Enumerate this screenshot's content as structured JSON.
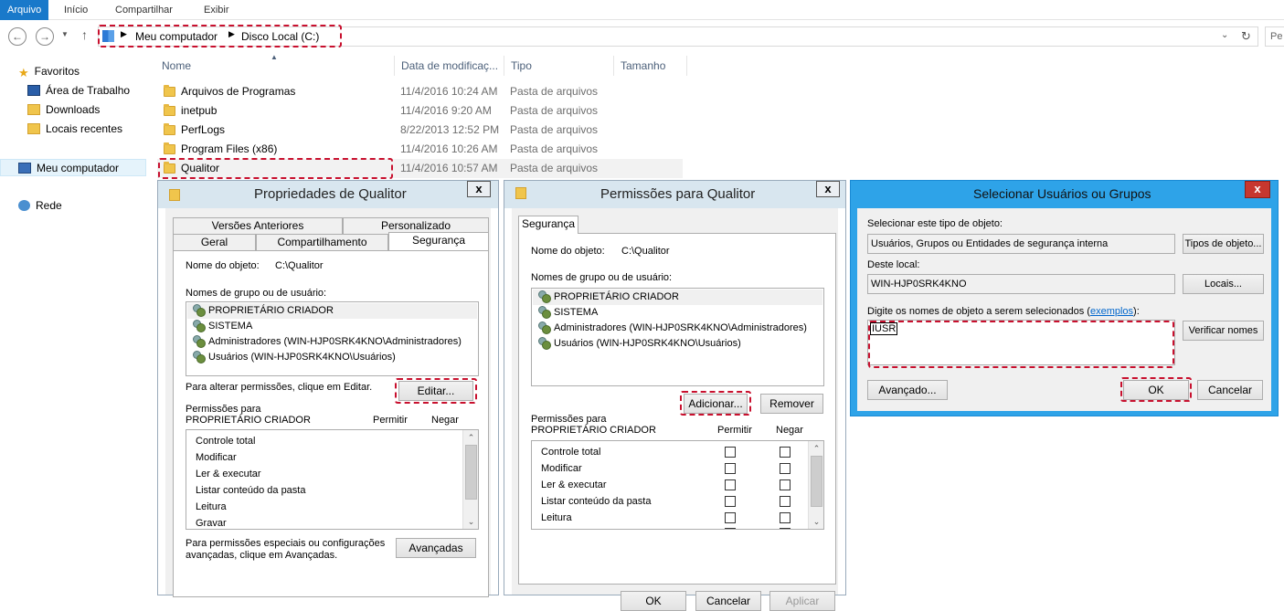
{
  "ribbon": {
    "tabs": [
      "Arquivo",
      "Início",
      "Compartilhar",
      "Exibir"
    ]
  },
  "address": {
    "part1": "Meu computador",
    "part2": "Disco Local (C:)",
    "search_placeholder": "Pe"
  },
  "nav": {
    "favorites": "Favoritos",
    "items": [
      "Área de Trabalho",
      "Downloads",
      "Locais recentes"
    ],
    "computer": "Meu computador",
    "network": "Rede"
  },
  "columns": {
    "name": "Nome",
    "date": "Data de modificaç...",
    "type": "Tipo",
    "size": "Tamanho"
  },
  "files": [
    {
      "name": "Arquivos de Programas",
      "date": "11/4/2016 10:24 AM",
      "type": "Pasta de arquivos"
    },
    {
      "name": "inetpub",
      "date": "11/4/2016 9:20 AM",
      "type": "Pasta de arquivos"
    },
    {
      "name": "PerfLogs",
      "date": "8/22/2013 12:52 PM",
      "type": "Pasta de arquivos"
    },
    {
      "name": "Program Files (x86)",
      "date": "11/4/2016 10:26 AM",
      "type": "Pasta de arquivos"
    },
    {
      "name": "Qualitor",
      "date": "11/4/2016 10:57 AM",
      "type": "Pasta de arquivos"
    }
  ],
  "props": {
    "title": "Propriedades de Qualitor",
    "tabs_top": [
      "Versões Anteriores",
      "Personalizado"
    ],
    "tabs_bottom": [
      "Geral",
      "Compartilhamento",
      "Segurança"
    ],
    "object_label": "Nome do objeto:",
    "object_value": "C:\\Qualitor",
    "groups_label": "Nomes de grupo ou de usuário:",
    "groups": [
      "PROPRIETÁRIO CRIADOR",
      "SISTEMA",
      "Administradores (WIN-HJP0SRK4KNO\\Administradores)",
      "Usuários (WIN-HJP0SRK4KNO\\Usuários)"
    ],
    "edit_hint": "Para alterar permissões, clique em Editar.",
    "edit_button": "Editar...",
    "perm_for": "Permissões para",
    "perm_for_who": "PROPRIETÁRIO CRIADOR",
    "allow": "Permitir",
    "deny": "Negar",
    "permissions": [
      "Controle total",
      "Modificar",
      "Ler & executar",
      "Listar conteúdo da pasta",
      "Leitura",
      "Gravar"
    ],
    "adv_hint_1": "Para permissões especiais ou configurações",
    "adv_hint_2": "avançadas, clique em Avançadas.",
    "adv_button": "Avançadas"
  },
  "perms": {
    "title": "Permissões para Qualitor",
    "tab": "Segurança",
    "object_label": "Nome do objeto:",
    "object_value": "C:\\Qualitor",
    "groups_label": "Nomes de grupo ou de usuário:",
    "groups": [
      "PROPRIETÁRIO CRIADOR",
      "SISTEMA",
      "Administradores (WIN-HJP0SRK4KNO\\Administradores)",
      "Usuários (WIN-HJP0SRK4KNO\\Usuários)"
    ],
    "add_button": "Adicionar...",
    "remove_button": "Remover",
    "perm_for": "Permissões para",
    "perm_for_who": "PROPRIETÁRIO CRIADOR",
    "allow": "Permitir",
    "deny": "Negar",
    "permissions": [
      "Controle total",
      "Modificar",
      "Ler & executar",
      "Listar conteúdo da pasta",
      "Leitura"
    ],
    "ok": "OK",
    "cancel": "Cancelar",
    "apply": "Aplicar"
  },
  "select": {
    "title": "Selecionar Usuários ou Grupos",
    "type_label": "Selecionar este tipo de objeto:",
    "type_value": "Usuários, Grupos ou Entidades de segurança interna",
    "type_button": "Tipos de objeto...",
    "loc_label": "Deste local:",
    "loc_value": "WIN-HJP0SRK4KNO",
    "loc_button": "Locais...",
    "names_label_pre": "Digite os nomes de objeto a serem selecionados (",
    "names_link": "exemplos",
    "names_label_post": "):",
    "names_value": "IUSR",
    "check_button": "Verificar nomes",
    "advanced_button": "Avançado...",
    "ok": "OK",
    "cancel": "Cancelar"
  }
}
